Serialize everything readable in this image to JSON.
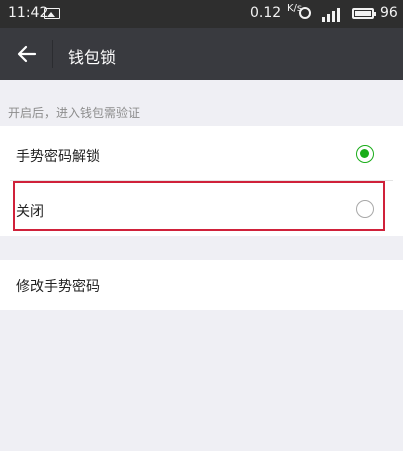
{
  "status_bar": {
    "time": "11:42",
    "net_speed": "0.12",
    "net_speed_unit": "K/s",
    "battery_level": "96"
  },
  "header": {
    "title": "钱包锁"
  },
  "hint": "开启后，进入钱包需验证",
  "options": [
    {
      "label": "手势密码解锁",
      "selected": true
    },
    {
      "label": "关闭",
      "selected": false
    }
  ],
  "modify_label": "修改手势密码",
  "colors": {
    "accent": "#1aad19",
    "highlight_border": "#d0213a",
    "titlebar_bg": "#393a3f",
    "statusbar_bg": "#2e2e2e"
  }
}
